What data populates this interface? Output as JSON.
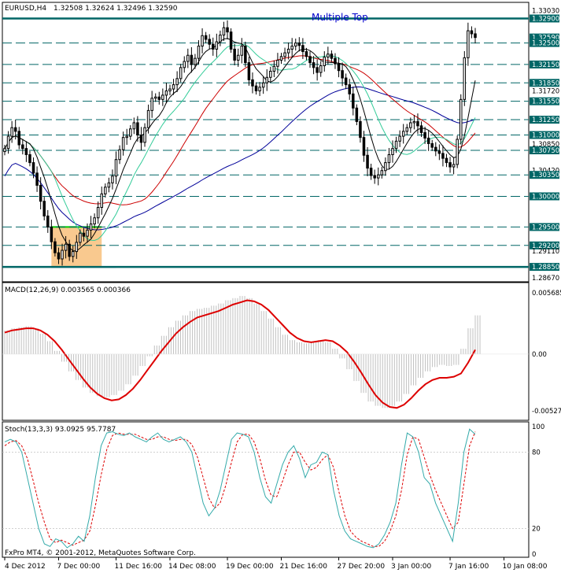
{
  "header": {
    "symbol": "EURUSD,H4",
    "ohlc": "1.32508 1.32624 1.32496 1.32590",
    "annotation": "Multiple Top",
    "copyright": "FxPro MT4, © 2001-2012, MetaQuotes Software Corp."
  },
  "colors": {
    "background": "#ffffff",
    "candle": "#000000",
    "level_line": "#006666",
    "ma_fast": "#000000",
    "ma_mid": "#33cc99",
    "ma_slow": "#cc0000",
    "ma_long": "#000099",
    "macd_hist": "#c0c0c0",
    "macd_signal": "#dd0000",
    "stoch_main": "#33aaaa",
    "stoch_signal": "#dd0000",
    "box_fill": "#f9c98f",
    "box_edge": "#00cc00"
  },
  "chart_data": [
    {
      "type": "candlestick",
      "title": "EURUSD,H4",
      "ylim": [
        1.2862,
        1.3315
      ],
      "y_ticks": [
        1.3303,
        1.329,
        1.3259,
        1.325,
        1.3215,
        1.3185,
        1.3172,
        1.3155,
        1.3125,
        1.31,
        1.3085,
        1.3075,
        1.3042,
        1.3035,
        1.3,
        1.295,
        1.292,
        1.2911,
        1.2885,
        1.2867
      ],
      "y_tick_labels": [
        "1.33030",
        "1.32900",
        "1.32590",
        "1.32500",
        "1.32150",
        "1.31850",
        "1.31720",
        "1.31550",
        "1.31250",
        "1.31000",
        "1.30850",
        "1.30750",
        "1.30420",
        "1.30350",
        "1.30000",
        "1.29500",
        "1.29200",
        "1.29110",
        "1.28850",
        "1.28670"
      ],
      "highlighted_ticks": [
        "1.32900",
        "1.32590",
        "1.32500",
        "1.32150",
        "1.31850",
        "1.31550",
        "1.31250",
        "1.31000",
        "1.30750",
        "1.30350",
        "1.30000",
        "1.29500",
        "1.29200",
        "1.28850"
      ],
      "levels": [
        1.329,
        1.325,
        1.3215,
        1.3185,
        1.3155,
        1.3125,
        1.31,
        1.3075,
        1.3035,
        1.3,
        1.295,
        1.292,
        1.2885
      ],
      "solid_levels": [
        1.329,
        1.2885
      ],
      "x_labels": [
        "4 Dec 2012",
        "7 Dec 00:00",
        "11 Dec 16:00",
        "14 Dec 08:00",
        "19 Dec 00:00",
        "21 Dec 16:00",
        "27 Dec 20:00",
        "3 Jan 00:00",
        "7 Jan 16:00",
        "10 Jan 08:00"
      ],
      "x_label_bars": [
        0,
        15,
        31,
        46,
        62,
        77,
        93,
        108,
        124,
        139
      ],
      "consolidation_box": {
        "bar_start": 13,
        "bar_end": 27,
        "low": 1.2885,
        "high": 1.295
      },
      "closes": [
        1.3078,
        1.3098,
        1.3112,
        1.3106,
        1.3084,
        1.3078,
        1.3068,
        1.3055,
        1.3038,
        1.3018,
        1.2992,
        1.2968,
        1.295,
        1.2926,
        1.2908,
        1.2898,
        1.2912,
        1.2922,
        1.2902,
        1.291,
        1.2925,
        1.294,
        1.2935,
        1.2945,
        1.2955,
        1.2965,
        1.2982,
        1.3004,
        1.3015,
        1.3022,
        1.3033,
        1.306,
        1.3076,
        1.3096,
        1.3098,
        1.311,
        1.312,
        1.31,
        1.3088,
        1.3112,
        1.314,
        1.316,
        1.3162,
        1.3158,
        1.3165,
        1.3172,
        1.3175,
        1.3182,
        1.3192,
        1.321,
        1.322,
        1.323,
        1.3215,
        1.3225,
        1.3245,
        1.3262,
        1.3256,
        1.3248,
        1.324,
        1.3252,
        1.3263,
        1.3275,
        1.3268,
        1.324,
        1.3222,
        1.323,
        1.3245,
        1.3218,
        1.319,
        1.318,
        1.3172,
        1.3178,
        1.3185,
        1.3194,
        1.3204,
        1.3212,
        1.3222,
        1.3228,
        1.3234,
        1.324,
        1.3245,
        1.325,
        1.3246,
        1.3236,
        1.3228,
        1.3218,
        1.321,
        1.3202,
        1.3213,
        1.3227,
        1.3232,
        1.3225,
        1.3216,
        1.3205,
        1.3193,
        1.3182,
        1.3167,
        1.3144,
        1.3122,
        1.3096,
        1.3067,
        1.3046,
        1.3034,
        1.303,
        1.3035,
        1.3042,
        1.3055,
        1.3068,
        1.3078,
        1.309,
        1.3098,
        1.3106,
        1.3112,
        1.312,
        1.3122,
        1.3115,
        1.3104,
        1.3095,
        1.3086,
        1.308,
        1.3074,
        1.307,
        1.3062,
        1.3055,
        1.3048,
        1.3052,
        1.3093,
        1.3158,
        1.3226,
        1.327,
        1.3265,
        1.3259
      ]
    },
    {
      "type": "line",
      "title": "MACD(12,26,9) 0.003565 0.000366",
      "ylim": [
        -0.006,
        0.0065
      ],
      "y_ticks": [
        0.005685,
        0.0,
        -0.00527
      ],
      "y_tick_labels": [
        "0.005685",
        "0.00",
        "-0.00527"
      ],
      "histogram": [
        0.0022,
        0.0024,
        0.0025,
        0.0026,
        0.0024,
        0.0019,
        0.0012,
        0.0003,
        -0.0007,
        -0.0016,
        -0.0024,
        -0.0031,
        -0.0036,
        -0.0039,
        -0.004,
        -0.0038,
        -0.0034,
        -0.0028,
        -0.002,
        -0.0011,
        -0.0002,
        0.0008,
        0.0017,
        0.0025,
        0.0031,
        0.0036,
        0.004,
        0.0042,
        0.0043,
        0.0045,
        0.0047,
        0.005,
        0.0052,
        0.0054,
        0.0052,
        0.0047,
        0.004,
        0.0033,
        0.0025,
        0.0018,
        0.0013,
        0.0011,
        0.001,
        0.0011,
        0.0013,
        0.0011,
        0.0005,
        -0.0004,
        -0.0014,
        -0.0025,
        -0.0036,
        -0.0044,
        -0.0048,
        -0.005,
        -0.0048,
        -0.0044,
        -0.0037,
        -0.0029,
        -0.0022,
        -0.0016,
        -0.0012,
        -0.001,
        -0.0011,
        -0.001,
        0.0005,
        0.0024,
        0.0036
      ],
      "signal": [
        0.002,
        0.0022,
        0.0023,
        0.0024,
        0.0024,
        0.0022,
        0.0018,
        0.0012,
        0.0004,
        -0.0005,
        -0.0014,
        -0.0023,
        -0.0031,
        -0.0037,
        -0.0041,
        -0.0043,
        -0.0042,
        -0.0038,
        -0.0032,
        -0.0024,
        -0.0015,
        -0.0006,
        0.0003,
        0.0011,
        0.0019,
        0.0025,
        0.003,
        0.0034,
        0.0036,
        0.0038,
        0.004,
        0.0043,
        0.0046,
        0.0048,
        0.005,
        0.0049,
        0.0046,
        0.0041,
        0.0034,
        0.0027,
        0.002,
        0.0015,
        0.0012,
        0.0011,
        0.0012,
        0.0013,
        0.0012,
        0.0008,
        0.0002,
        -0.0007,
        -0.0017,
        -0.0028,
        -0.0038,
        -0.0045,
        -0.0049,
        -0.005,
        -0.0047,
        -0.0041,
        -0.0034,
        -0.0028,
        -0.0024,
        -0.0022,
        -0.0022,
        -0.0021,
        -0.0018,
        -0.0008,
        0.0004
      ]
    },
    {
      "type": "line",
      "title": "Stoch(13,3,3) 93.0925 95.7787",
      "ylim": [
        0,
        100
      ],
      "y_ticks": [
        100,
        80,
        20,
        0
      ],
      "y_tick_labels": [
        "100",
        "80",
        "20",
        "0"
      ],
      "main": [
        88,
        90,
        88,
        80,
        60,
        40,
        20,
        8,
        6,
        12,
        10,
        5,
        8,
        14,
        10,
        30,
        60,
        85,
        95,
        96,
        94,
        93,
        95,
        92,
        90,
        88,
        92,
        95,
        90,
        88,
        90,
        92,
        88,
        80,
        60,
        40,
        30,
        36,
        50,
        70,
        90,
        95,
        94,
        92,
        80,
        60,
        45,
        40,
        55,
        70,
        80,
        85,
        75,
        60,
        70,
        72,
        80,
        78,
        50,
        30,
        18,
        12,
        10,
        8,
        6,
        5,
        8,
        15,
        25,
        40,
        70,
        95,
        92,
        80,
        60,
        55,
        40,
        30,
        20,
        10,
        40,
        80,
        98,
        94
      ],
      "signal": [
        85,
        88,
        89,
        85,
        75,
        58,
        40,
        25,
        12,
        9,
        11,
        9,
        7,
        9,
        11,
        18,
        38,
        62,
        82,
        93,
        95,
        94,
        94,
        94,
        92,
        90,
        90,
        92,
        92,
        90,
        89,
        90,
        90,
        86,
        76,
        60,
        44,
        36,
        40,
        54,
        72,
        88,
        94,
        94,
        88,
        75,
        58,
        46,
        45,
        57,
        70,
        80,
        80,
        72,
        66,
        68,
        74,
        78,
        68,
        48,
        30,
        18,
        13,
        10,
        8,
        6,
        6,
        10,
        18,
        30,
        50,
        78,
        92,
        90,
        76,
        62,
        50,
        40,
        30,
        20,
        25,
        55,
        85,
        96
      ]
    }
  ]
}
